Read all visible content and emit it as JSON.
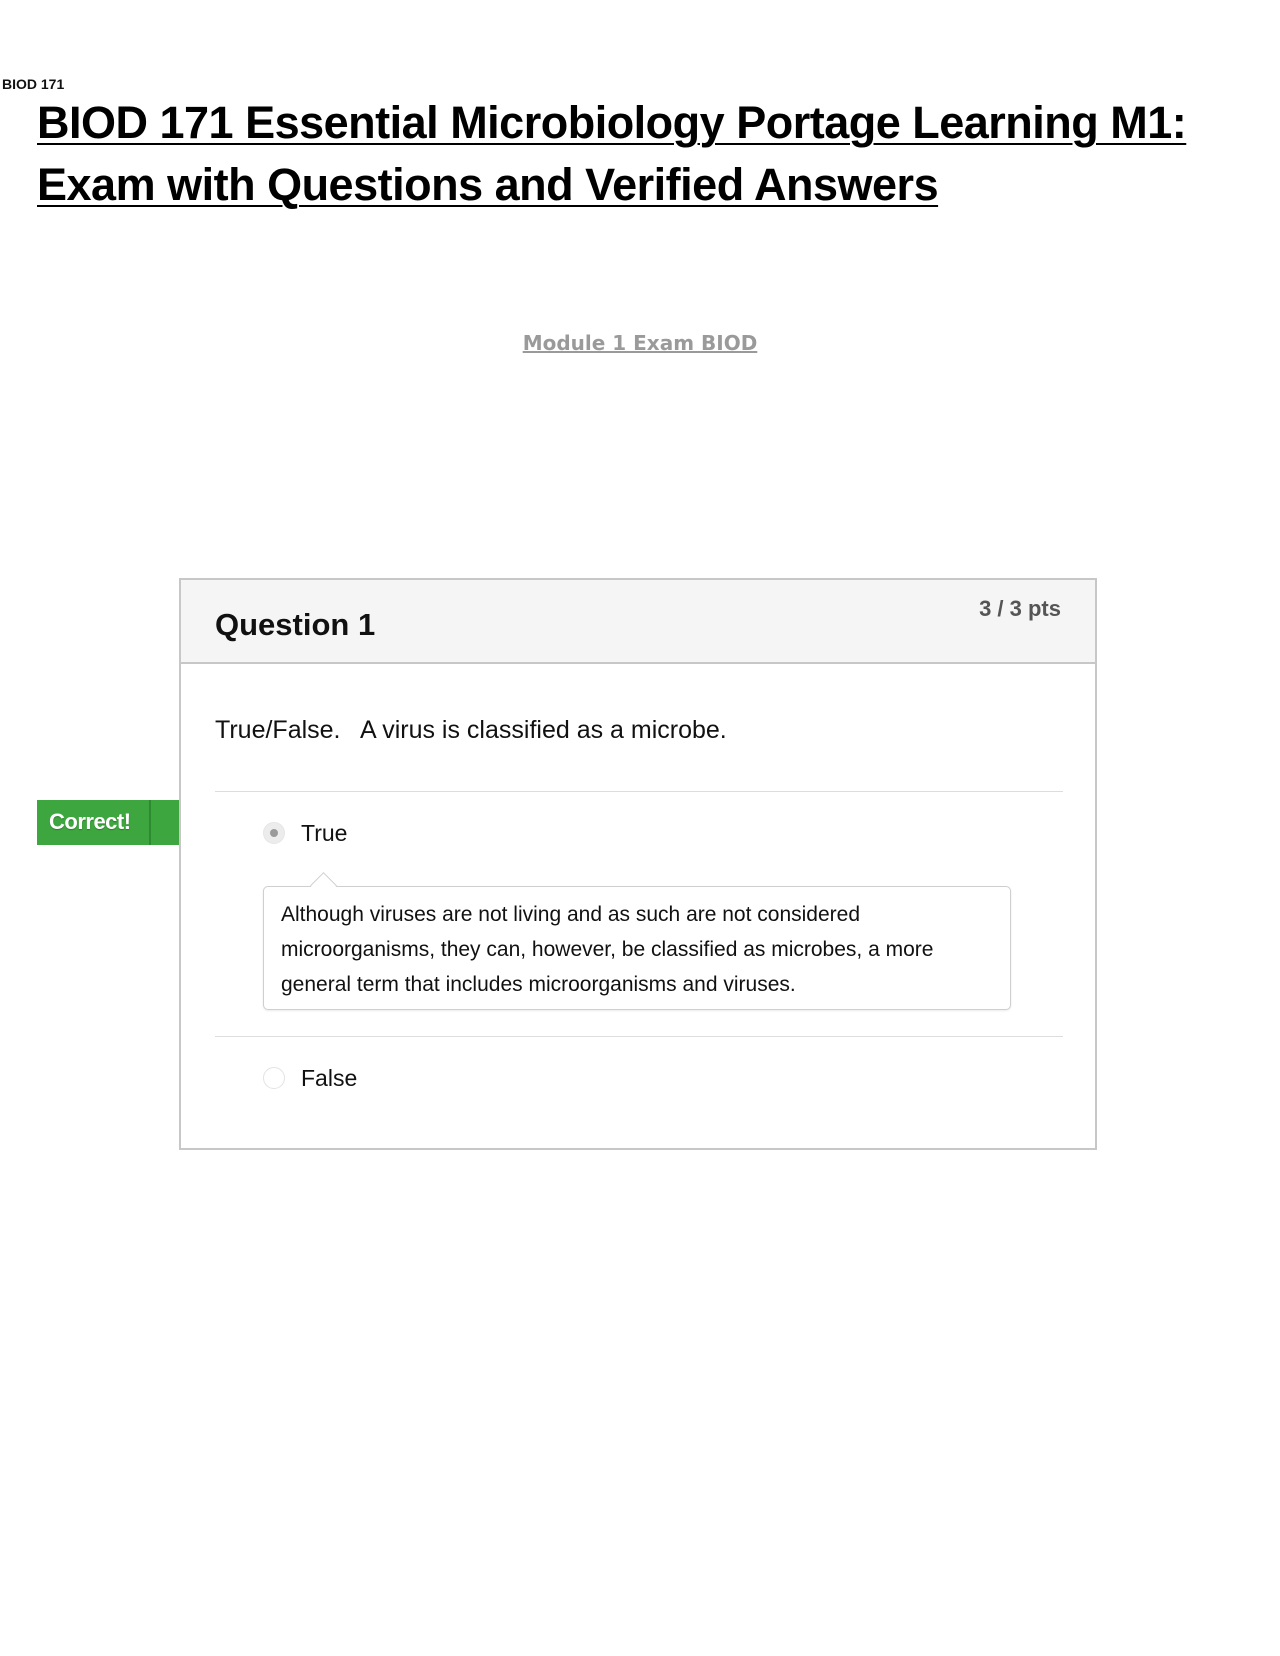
{
  "document": {
    "course_tag": "BIOD 171",
    "title": "BIOD 171 Essential Microbiology Portage Learning M1: Exam with Questions and Verified Answers",
    "module_link": "Module 1 Exam BIOD"
  },
  "question": {
    "title": "Question 1",
    "points": "3 / 3 pts",
    "text": "True/False.   A virus is classified as a microbe.",
    "status_badge": "Correct!",
    "answers": [
      {
        "label": "True",
        "selected": true
      },
      {
        "label": "False",
        "selected": false
      }
    ],
    "feedback": "Although viruses are not living and as such are not considered microorganisms, they can, however, be classified as microbes, a more general term that includes microorganisms and viruses."
  },
  "colors": {
    "badge_green": "#3da63e",
    "badge_green_dark": "#2e8a30",
    "border": "#c7c7c7",
    "header_bg": "#f5f5f5",
    "link_gray": "#9a9a9a"
  }
}
